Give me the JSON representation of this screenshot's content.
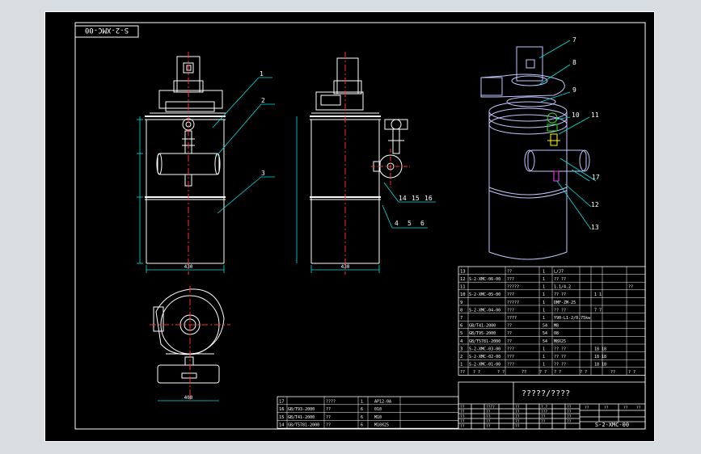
{
  "drawing": {
    "code_box": "S-2-XMC-00",
    "title_field": "?????/????",
    "drawing_number": "S-2-XMC-00",
    "colors": {
      "background": "#000000",
      "frame": "#ffffff",
      "centerline": "#ff3030",
      "outline": "#ffffff",
      "leader": "#00e5e5",
      "accent_yellow": "#ffff00"
    }
  },
  "balloons": {
    "front": [
      "1",
      "2",
      "3"
    ],
    "side": [
      "14",
      "15",
      "16",
      "4",
      "5",
      "6"
    ],
    "iso": [
      "7",
      "8",
      "9",
      "10",
      "11",
      "12",
      "13",
      "17"
    ]
  },
  "dimensions": {
    "front_width": "430",
    "bottom_width": "400",
    "side_width": "430"
  },
  "bom_upper": {
    "rows": [
      {
        "no": "13",
        "code": "",
        "name": "??",
        "qty": "1",
        "mat": "L/J7",
        "wt": "",
        "note": ""
      },
      {
        "no": "12",
        "code": "S-2-XMC-06-00",
        "name": "???",
        "qty": "1",
        "mat": "?? ??",
        "wt": "",
        "note": ""
      },
      {
        "no": "11",
        "code": "",
        "name": "?????",
        "qty": "1",
        "mat": "1.1/4.2",
        "wt": "",
        "note": "??"
      },
      {
        "no": "10",
        "code": "S-2-XMC-05-00",
        "name": "???",
        "qty": "1",
        "mat": "?? ??",
        "wt": "1  1",
        "note": ""
      },
      {
        "no": "9",
        "code": "",
        "name": "?????",
        "qty": "1",
        "mat": "DMF-ZM-25",
        "wt": "",
        "note": ""
      },
      {
        "no": "8",
        "code": "S-2-XMC-04-00",
        "name": "???",
        "qty": "1",
        "mat": "?? ??",
        "wt": "7  7",
        "note": ""
      },
      {
        "no": "7",
        "code": "",
        "name": "????",
        "qty": "1",
        "mat": "Y90-L1-2/0.75kw",
        "wt": "",
        "note": ""
      },
      {
        "no": "6",
        "code": "GB/T41-2000",
        "name": "??",
        "qty": "54",
        "mat": "M8",
        "wt": "",
        "note": ""
      },
      {
        "no": "5",
        "code": "GB/T95-2000",
        "name": "??",
        "qty": "54",
        "mat": "08",
        "wt": "",
        "note": ""
      },
      {
        "no": "4",
        "code": "GB/T5781-2000",
        "name": "??",
        "qty": "54",
        "mat": "M8X25",
        "wt": "",
        "note": ""
      },
      {
        "no": "3",
        "code": "S-2-XMC-03-00",
        "name": "???",
        "qty": "1",
        "mat": "?? ??",
        "wt": "18  18",
        "note": ""
      },
      {
        "no": "2",
        "code": "S-2-XMC-02-00",
        "name": "???",
        "qty": "1",
        "mat": "?? ??",
        "wt": "18  18",
        "note": ""
      },
      {
        "no": "1",
        "code": "S-2-XMC-01-00",
        "name": "???",
        "qty": "1",
        "mat": "?? ??",
        "wt": "18  18",
        "note": ""
      }
    ],
    "header": [
      "??",
      "? ?",
      "? ?",
      "??",
      "? ?",
      "? ?",
      "? ?",
      "??",
      "? ?"
    ]
  },
  "bom_lower": {
    "rows": [
      {
        "no": "17",
        "code": "",
        "name": "????",
        "qty": "1",
        "mat": "AP12-0A"
      },
      {
        "no": "16",
        "code": "GB/T93-2000",
        "name": "??",
        "qty": "6",
        "mat": "010"
      },
      {
        "no": "15",
        "code": "GB/T41-2000",
        "name": "??",
        "qty": "6",
        "mat": "M10"
      },
      {
        "no": "14",
        "code": "GB/T5781-2000",
        "name": "??",
        "qty": "6",
        "mat": "M10X25"
      }
    ]
  },
  "title_block": {
    "cells": [
      "??",
      "????",
      "??",
      "?.?",
      "??",
      "??",
      "??",
      "??",
      "???",
      "??",
      "??",
      "??",
      "??",
      "??",
      "??",
      "??",
      "??",
      "??",
      "??",
      "??",
      "??",
      "??",
      "??"
    ],
    "scale_row": [
      "??",
      "??",
      "??",
      "??"
    ]
  }
}
